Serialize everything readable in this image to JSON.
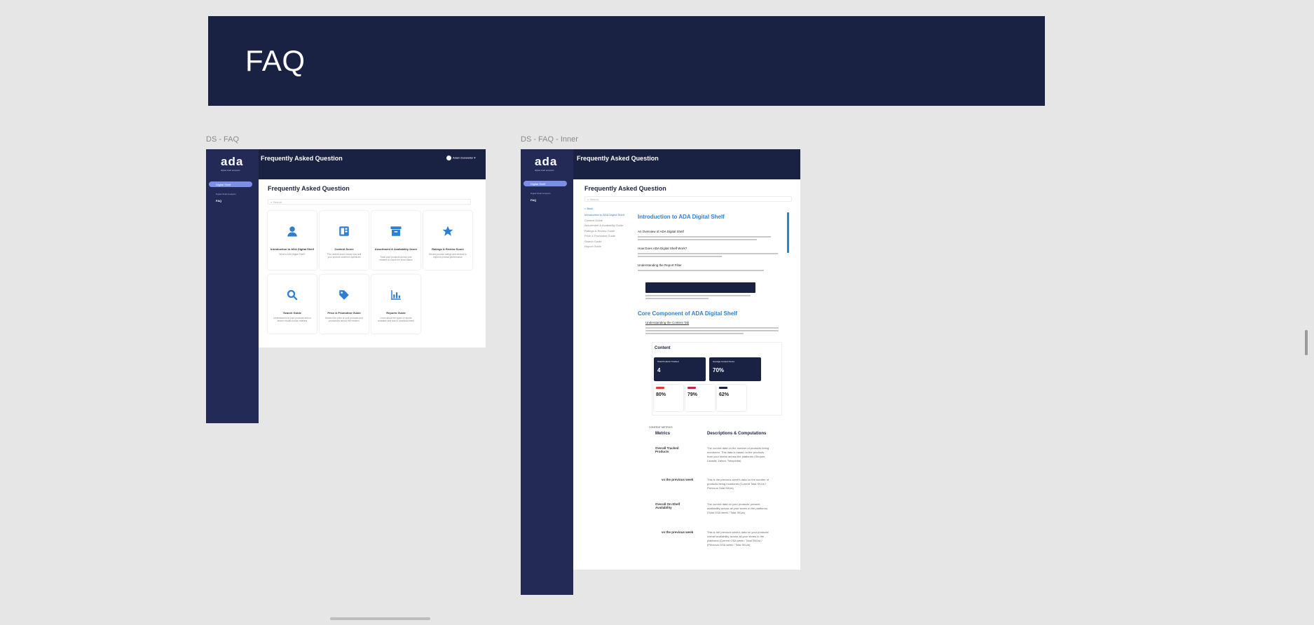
{
  "banner": {
    "title": "FAQ"
  },
  "frames": {
    "faq": {
      "label": "DS - FAQ"
    },
    "inner": {
      "label": "DS - FAQ - Inner"
    }
  },
  "app": {
    "logo": "ada",
    "logo_sub": "digital shelf analytics",
    "nav_active": "Digital Shelf",
    "nav_sub": "Digital Shelf Analytics",
    "nav_item": "FAQ",
    "topbar_title": "Frequently Asked Question",
    "user_name": "Adam Danweller",
    "page_title": "Frequently Asked Question",
    "search_placeholder": "Search"
  },
  "cards": [
    {
      "title": "Introduction to ADA Digital Shelf",
      "desc": "What is ADA Digital Shelf?",
      "icon": "person-icon"
    },
    {
      "title": "Content Score",
      "desc": "The content score shows how well your product content is optimized",
      "icon": "content-icon"
    },
    {
      "title": "Assortment & Availability Score",
      "desc": "Track your products across your retailers to check the stock status",
      "icon": "archive-icon"
    },
    {
      "title": "Ratings & Review Score",
      "desc": "Review product ratings and reviews to improve product performance",
      "icon": "star-icon"
    },
    {
      "title": "Search Guide",
      "desc": "Understand how your products rank in search results across retailers",
      "icon": "search-icon"
    },
    {
      "title": "Price & Promotion Guide",
      "desc": "Monitor the price of your products and promotions across the retailers",
      "icon": "tag-icon"
    },
    {
      "title": "Reports Guide",
      "desc": "Learn about the types of reports available and how to download them",
      "icon": "chart-icon"
    }
  ],
  "inner": {
    "back": "< Back",
    "toc": [
      "Introduction to ADA Digital Shelf",
      "Content Guide",
      "Assortment & Availability Guide",
      "Ratings & Review Guide",
      "Price & Promotion Guide",
      "Search Guide",
      "Report Guide"
    ],
    "section1_title": "Introduction to ADA Digital Shelf",
    "q1": "An Overview of ADA Digital Shelf",
    "q2": "How Does ADA Digital Shelf Work?",
    "q3": "Understanding the Report Filter",
    "section2_title": "Core Component of ADA Digital Shelf",
    "link1": "Understanding the Content Tab",
    "dash_title": "Content",
    "kpis": [
      {
        "label": "Total Products Tracked",
        "value": "4"
      },
      {
        "label": "Average Content Score",
        "value": "70%"
      }
    ],
    "minis": [
      {
        "value": "80%",
        "color": "#e23a3a"
      },
      {
        "value": "79%",
        "color": "#c0224a"
      },
      {
        "value": "62%",
        "color": "#1a2244"
      }
    ],
    "table_caption": "CONTENT METRICS",
    "col1": "Metrics",
    "col2": "Descriptions & Computations",
    "rows": [
      {
        "metric": "Overall Tracked Products",
        "desc": "The current data on the number of products being monitored. This data is based on the products from your stores across the platforms (Shopee, Lazada, Zalora, Tokopedia)"
      },
      {
        "metric": "vs the previous week",
        "desc": "This is the previous week's data on the number of products being monitored (Current Total SKUs / Previous Total SKUs)"
      },
      {
        "metric": "Overall On-Shelf Availability",
        "desc": "The current data on your products' percent availability across all your stores in the platforms. (Total OSA week / Total SKUs)"
      },
      {
        "metric": "vs the previous week",
        "desc": "This is the previous week's data on your products' overall availability across all your stores in the platforms (Current OSA week / Total SKUs) / (Previous OSA week / Total SKUs)"
      }
    ]
  }
}
